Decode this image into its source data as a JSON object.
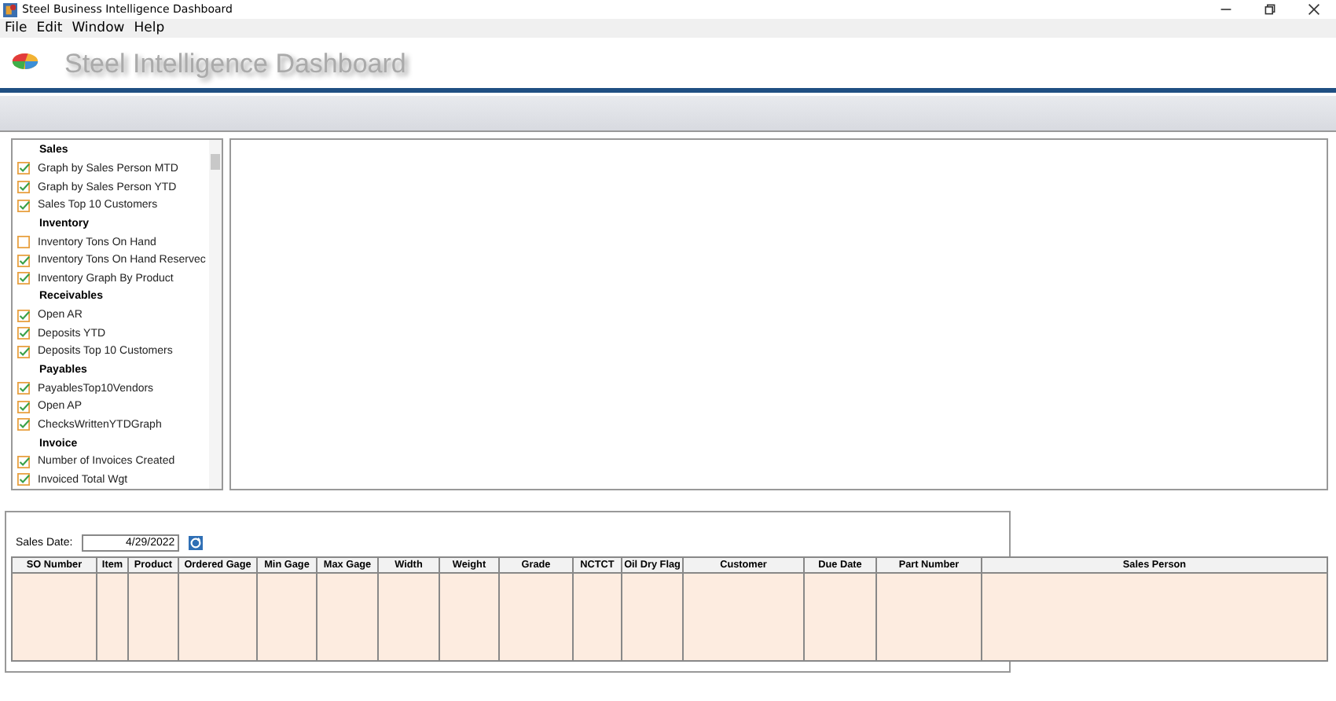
{
  "window": {
    "title": "Steel Business Intelligence Dashboard"
  },
  "menu": [
    "File",
    "Edit",
    "Window",
    "Help"
  ],
  "header": {
    "title": "Steel Intelligence Dashboard"
  },
  "report_list": [
    {
      "kind": "group",
      "label": "Sales"
    },
    {
      "kind": "item",
      "label": "Graph by Sales Person MTD",
      "checked": true
    },
    {
      "kind": "item",
      "label": "Graph by Sales Person YTD",
      "checked": true
    },
    {
      "kind": "item",
      "label": "Sales Top 10 Customers",
      "checked": true
    },
    {
      "kind": "group",
      "label": "Inventory"
    },
    {
      "kind": "item",
      "label": "Inventory Tons On Hand",
      "checked": false
    },
    {
      "kind": "item",
      "label": "Inventory Tons On Hand Reservec",
      "checked": true
    },
    {
      "kind": "item",
      "label": "Inventory Graph By Product",
      "checked": true
    },
    {
      "kind": "group",
      "label": "Receivables"
    },
    {
      "kind": "item",
      "label": "Open AR",
      "checked": true
    },
    {
      "kind": "item",
      "label": "Deposits YTD",
      "checked": true
    },
    {
      "kind": "item",
      "label": "Deposits Top 10 Customers",
      "checked": true
    },
    {
      "kind": "group",
      "label": "Payables"
    },
    {
      "kind": "item",
      "label": "PayablesTop10Vendors",
      "checked": true
    },
    {
      "kind": "item",
      "label": "Open AP",
      "checked": true
    },
    {
      "kind": "item",
      "label": "ChecksWrittenYTDGraph",
      "checked": true
    },
    {
      "kind": "group",
      "label": "Invoice"
    },
    {
      "kind": "item",
      "label": "Number of Invoices Created",
      "checked": true
    },
    {
      "kind": "item",
      "label": "Invoiced Total Wgt",
      "checked": true
    }
  ],
  "sales_date": {
    "label": "Sales Date:",
    "value": "4/29/2022"
  },
  "table": {
    "columns": [
      "SO Number",
      "Item",
      "Product",
      "Ordered Gage",
      "Min Gage",
      "Max Gage",
      "Width",
      "Weight",
      "Grade",
      "NCTCT",
      "Oil Dry Flag",
      "Customer",
      "Due Date",
      "Part Number",
      "Sales Person"
    ]
  }
}
